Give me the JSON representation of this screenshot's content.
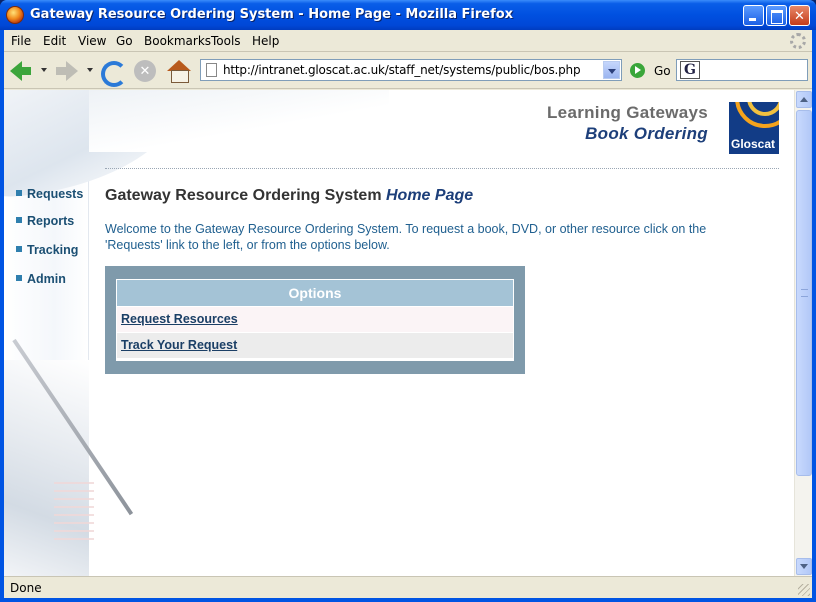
{
  "window": {
    "title": "Gateway Resource Ordering System - Home Page - Mozilla Firefox"
  },
  "menubar": {
    "items": [
      {
        "label": "File"
      },
      {
        "label": "Edit"
      },
      {
        "label": "View"
      },
      {
        "label": "Go"
      },
      {
        "label": "Bookmarks"
      },
      {
        "label": "Tools"
      },
      {
        "label": "Help"
      }
    ]
  },
  "toolbar": {
    "url": "http://intranet.gloscat.ac.uk/staff_net/systems/public/bos.php",
    "go_label": "Go",
    "search_engine_glyph": "G",
    "search_value": ""
  },
  "page": {
    "brand": {
      "line1": "Learning Gateways",
      "line2": "Book Ordering",
      "logo_text": "Gloscat"
    },
    "nav": [
      {
        "label": "Requests"
      },
      {
        "label": "Reports"
      },
      {
        "label": "Tracking"
      },
      {
        "label": "Admin"
      }
    ],
    "title_main": "Gateway Resource Ordering System ",
    "title_em": "Home Page",
    "intro": "Welcome to the Gateway Resource Ordering System. To request a book, DVD, or other resource click on the 'Requests' link to the left, or from the options below.",
    "options": {
      "heading": "Options",
      "links": [
        {
          "label": "Request Resources"
        },
        {
          "label": "Track Your Request"
        }
      ]
    }
  },
  "statusbar": {
    "text": "Done"
  },
  "colors": {
    "titlebar": "#0054e3",
    "chrome": "#ece9d8",
    "nav_link": "#1b4f73",
    "intro_text": "#1f5f8f",
    "options_frame": "#7f9aab",
    "options_header": "#a4c3d6",
    "logo_bg": "#123c86"
  },
  "icons": {
    "app": "firefox-icon",
    "back": "back-arrow-icon",
    "forward": "forward-arrow-icon",
    "reload": "reload-icon",
    "stop": "stop-icon",
    "home": "home-icon",
    "go": "go-icon"
  }
}
